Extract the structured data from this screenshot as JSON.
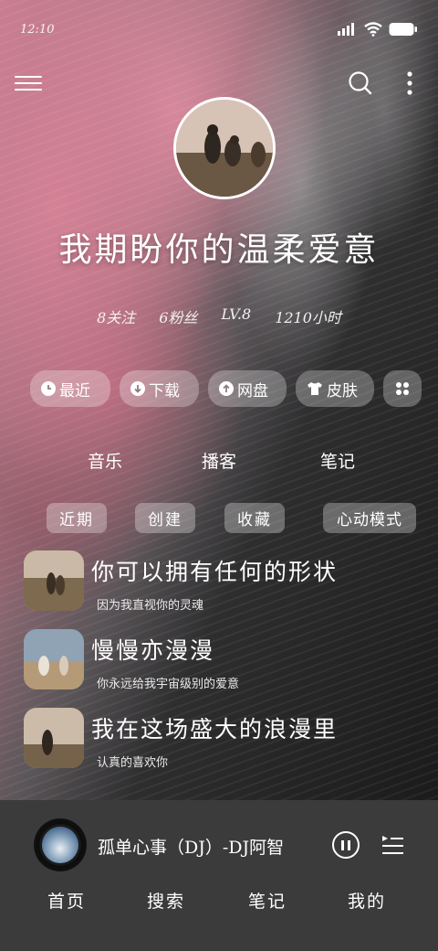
{
  "status_bar": {
    "time": "12:10"
  },
  "profile": {
    "nickname": "我期盼你的温柔爱意",
    "stats": [
      "8关注",
      "6粉丝",
      "LV.8",
      "1210小时"
    ]
  },
  "quick_actions": [
    {
      "label": "最近",
      "icon": "clock-icon"
    },
    {
      "label": "下载",
      "icon": "download-icon"
    },
    {
      "label": "网盘",
      "icon": "cloud-upload-icon"
    },
    {
      "label": "皮肤",
      "icon": "tshirt-icon"
    },
    {
      "label": "",
      "icon": "apps-grid-icon"
    }
  ],
  "main_tabs": [
    "音乐",
    "播客",
    "笔记"
  ],
  "sub_tabs": [
    "近期",
    "创建",
    "收藏",
    "心动模式"
  ],
  "songs": [
    {
      "title": "你可以拥有任何的形状",
      "subtitle": "因为我直视你的灵魂"
    },
    {
      "title": "慢慢亦漫漫",
      "subtitle": "你永远给我宇宙级别的爱意"
    },
    {
      "title": "我在这场盛大的浪漫里",
      "subtitle": "认真的喜欢你"
    }
  ],
  "player": {
    "track": "孤单心事（DJ）-DJ阿智"
  },
  "bottom_nav": [
    "首页",
    "搜索",
    "笔记",
    "我的"
  ],
  "colors": {
    "player_bg": "#3b3b3b",
    "chip_bg": "rgba(255,255,255,0.28)"
  }
}
